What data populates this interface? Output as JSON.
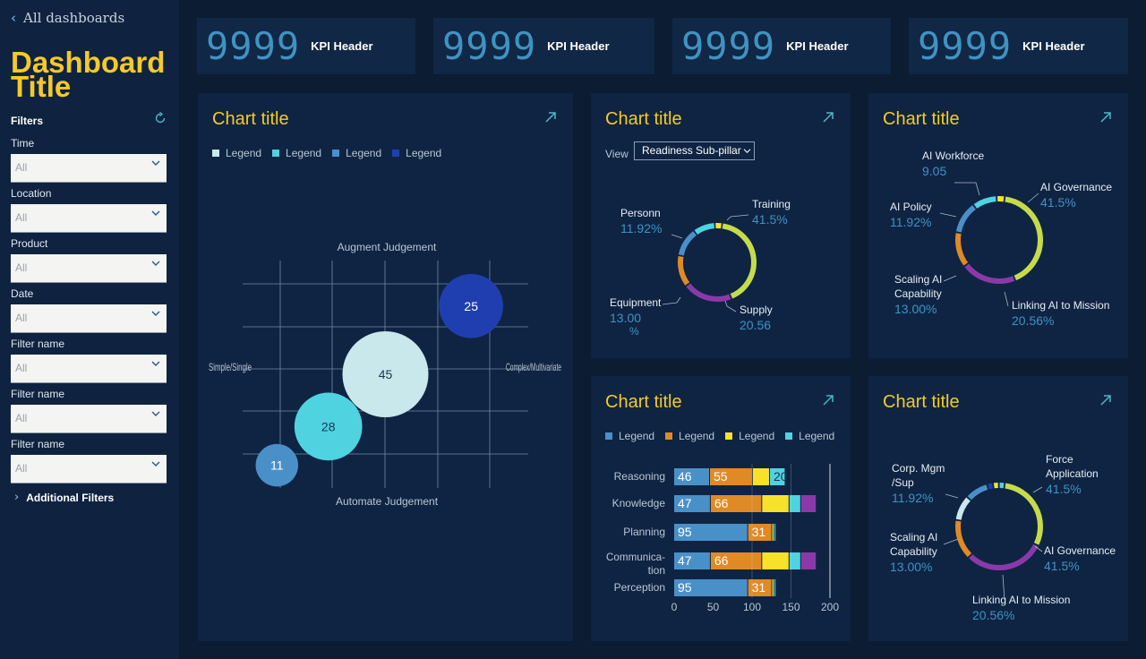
{
  "nav": {
    "back_label": "All dashboards"
  },
  "dashboard": {
    "title": "Dashboard Title"
  },
  "filters": {
    "heading": "Filters",
    "items": [
      {
        "label": "Time",
        "value": "All"
      },
      {
        "label": "Location",
        "value": "All"
      },
      {
        "label": "Product",
        "value": "All"
      },
      {
        "label": "Date",
        "value": "All"
      },
      {
        "label": "Filter name",
        "value": "All"
      },
      {
        "label": "Filter name",
        "value": "All"
      },
      {
        "label": "Filter name",
        "value": "All"
      }
    ],
    "additional": "Additional Filters"
  },
  "kpis": [
    {
      "value": "9999",
      "label": "KPI Header"
    },
    {
      "value": "9999",
      "label": "KPI Header"
    },
    {
      "value": "9999",
      "label": "KPI Header"
    },
    {
      "value": "9999",
      "label": "KPI Header"
    }
  ],
  "colors": {
    "yellow": "#f5c928",
    "kpi_blue": "#3e93c2",
    "lightblue": "#4a90c8",
    "orange": "#e08a26",
    "gold": "#f8e12b",
    "cyan": "#4fd3e0",
    "purple": "#8a3aa8",
    "lime": "#c5dc4a",
    "pale": "#c8e8ec",
    "navy": "#1f3fb0"
  },
  "panels": {
    "bubble": {
      "title": "Chart title",
      "legend": [
        "Legend",
        "Legend",
        "Legend",
        "Legend"
      ]
    },
    "donut1": {
      "title": "Chart title",
      "view_label": "View",
      "view_value": "Readiness Sub-pillar"
    },
    "donut2": {
      "title": "Chart title"
    },
    "bars": {
      "title": "Chart title",
      "legend": [
        "Legend",
        "Legend",
        "Legend",
        "Legend"
      ]
    },
    "donut3": {
      "title": "Chart title"
    }
  },
  "chart_data": [
    {
      "type": "scatter",
      "title": "Chart title",
      "quadrant_labels": {
        "top": "Augment Judgement",
        "bottom": "Automate Judgement",
        "left": "Simple/Single",
        "right": "Complex/Multivariate"
      },
      "legend": [
        "Legend",
        "Legend",
        "Legend",
        "Legend"
      ],
      "points": [
        {
          "x": 0.5,
          "y": 0.5,
          "value": 45,
          "color": "#c8e8ec"
        },
        {
          "x": 0.8,
          "y": 0.8,
          "value": 25,
          "color": "#1f3fb0"
        },
        {
          "x": 0.3,
          "y": 0.27,
          "value": 28,
          "color": "#4fd3e0"
        },
        {
          "x": 0.12,
          "y": 0.1,
          "value": 11,
          "color": "#4a90c8"
        }
      ]
    },
    {
      "type": "pie",
      "title": "Chart title",
      "segments": [
        {
          "name": "Training",
          "value": 41.5,
          "value_label": "41.5%",
          "color": "#c5dc4a"
        },
        {
          "name": "Supply",
          "value": 20.56,
          "value_label": "20.56",
          "color": "#8a3aa8"
        },
        {
          "name": "Equipment",
          "value": 13.0,
          "value_label": "13.00",
          "color": "#e08a26"
        },
        {
          "name": "Personnel",
          "value": 11.92,
          "value_label": "11.92%",
          "color": "#4a90c8"
        },
        {
          "name": "",
          "value": 9.05,
          "value_label": "",
          "color": "#4fd3e0"
        },
        {
          "name": "",
          "value": 3,
          "value_label": "",
          "color": "#f8e12b"
        }
      ]
    },
    {
      "type": "pie",
      "title": "Chart title",
      "segments": [
        {
          "name": "AI Governance",
          "value": 41.5,
          "value_label": "41.5%",
          "color": "#c5dc4a"
        },
        {
          "name": "Linking AI to Mission",
          "value": 20.56,
          "value_label": "20.56%",
          "color": "#8a3aa8"
        },
        {
          "name": "Scaling AI Capability",
          "value": 13.0,
          "value_label": "13.00%",
          "color": "#e08a26"
        },
        {
          "name": "AI Policy",
          "value": 11.92,
          "value_label": "11.92%",
          "color": "#4a90c8"
        },
        {
          "name": "AI Workforce",
          "value": 9.05,
          "value_label": "9.05",
          "color": "#4fd3e0"
        },
        {
          "name": "",
          "value": 3,
          "value_label": "",
          "color": "#f8e12b"
        }
      ]
    },
    {
      "type": "bar",
      "orientation": "horizontal",
      "stacked": true,
      "title": "Chart title",
      "categories": [
        "Reasoning",
        "Knowledge",
        "Planning",
        "Communication",
        "Perception"
      ],
      "xlim": [
        0,
        200
      ],
      "xticks": [
        0,
        50,
        100,
        150,
        200
      ],
      "series": [
        {
          "name": "Legend",
          "color": "#4a90c8",
          "values": [
            46,
            47,
            95,
            47,
            95
          ]
        },
        {
          "name": "Legend",
          "color": "#e08a26",
          "values": [
            55,
            66,
            31,
            66,
            31
          ]
        },
        {
          "name": "Legend",
          "color": "#f8e12b",
          "values": [
            22,
            35,
            3,
            35,
            3
          ]
        },
        {
          "name": "Legend",
          "color": "#4fd3e0",
          "values": [
            20,
            15,
            2,
            15,
            2
          ]
        },
        {
          "name": "",
          "color": "#8a3aa8",
          "values": [
            0,
            20,
            0,
            20,
            0
          ]
        }
      ],
      "labels_shown": [
        [
          46,
          55,
          null,
          20,
          null
        ],
        [
          47,
          66,
          null,
          null,
          null
        ],
        [
          95,
          31,
          null,
          null,
          null
        ],
        [
          47,
          66,
          null,
          null,
          null
        ],
        [
          95,
          31,
          null,
          null,
          null
        ]
      ]
    },
    {
      "type": "pie",
      "title": "Chart title",
      "segments": [
        {
          "name": "Force Application",
          "value": 41.5,
          "value_label": "41.5%",
          "color": "#c5dc4a"
        },
        {
          "name": "AI Governance",
          "value": 41.5,
          "value_label": "41.5%",
          "color": "#8a3aa8"
        },
        {
          "name": "Linking AI to Mission",
          "value": 20.56,
          "value_label": "20.56%",
          "color": "#e08a26"
        },
        {
          "name": "Scaling AI Capability",
          "value": 13.0,
          "value_label": "13.00%",
          "color": "#c8e8ec"
        },
        {
          "name": "Corp. Mgmt/Sup",
          "value": 11.92,
          "value_label": "11.92%",
          "color": "#4a90c8"
        },
        {
          "name": "",
          "value": 3,
          "value_label": "",
          "color": "#1f3fb0"
        },
        {
          "name": "",
          "value": 3,
          "value_label": "",
          "color": "#f8e12b"
        },
        {
          "name": "",
          "value": 3,
          "value_label": "",
          "color": "#4fd3e0"
        }
      ]
    }
  ]
}
